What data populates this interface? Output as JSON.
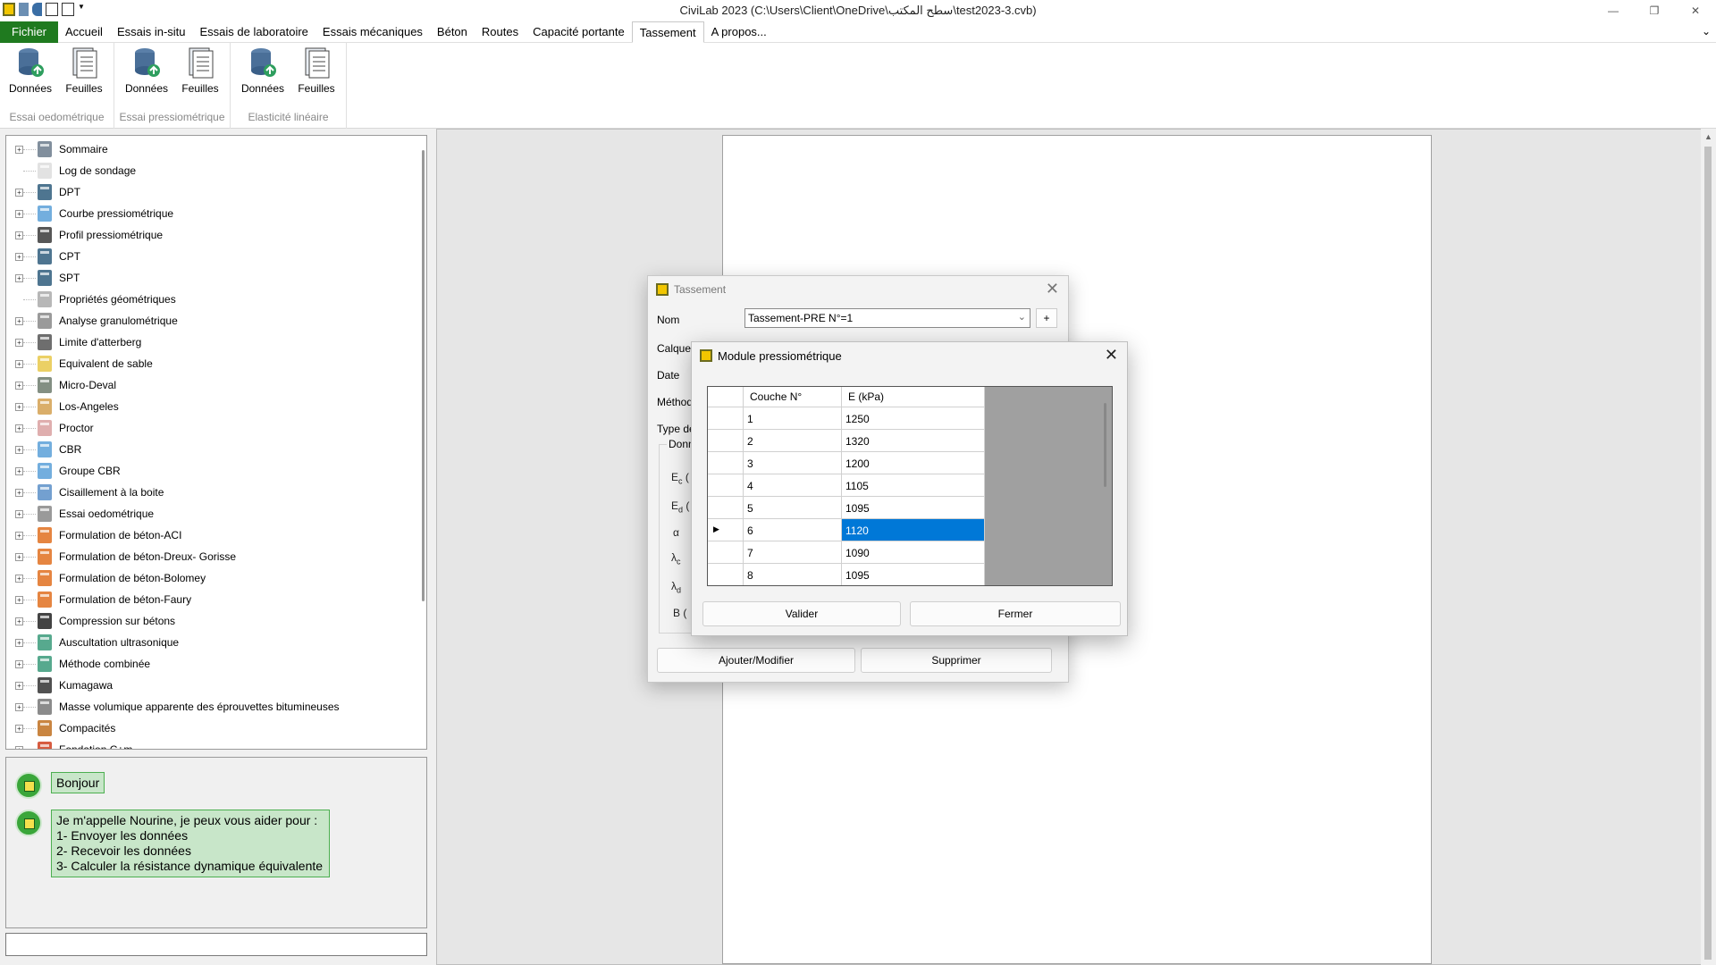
{
  "window": {
    "title": "CiviLab  2023 (C:\\Users\\Client\\OneDrive\\سطح المكتب\\test2023-3.cvb)",
    "minimize": "—",
    "restore": "❐",
    "close": "✕"
  },
  "menu": {
    "items": [
      "Fichier",
      "Accueil",
      "Essais in-situ",
      "Essais de laboratoire",
      "Essais mécaniques",
      "Béton",
      "Routes",
      "Capacité portante",
      "Tassement",
      "A propos..."
    ],
    "active": "Tassement",
    "chevron": "⌄"
  },
  "ribbon": {
    "groups": [
      {
        "label": "Essai oedométrique",
        "buttons": [
          "Données",
          "Feuilles"
        ]
      },
      {
        "label": "Essai pressiométrique",
        "buttons": [
          "Données",
          "Feuilles"
        ]
      },
      {
        "label": "Elasticité linéaire",
        "buttons": [
          "Données",
          "Feuilles"
        ]
      }
    ]
  },
  "tree": {
    "items": [
      "Sommaire",
      "Log de sondage",
      "DPT",
      "Courbe pressiométrique",
      "Profil pressiométrique",
      "CPT",
      "SPT",
      "Propriétés géométriques",
      "Analyse granulométrique",
      "Limite d'atterberg",
      "Equivalent de sable",
      "Micro-Deval",
      "Los-Angeles",
      "Proctor",
      "CBR",
      "Groupe CBR",
      "Cisaillement à la boite",
      "Essai oedométrique",
      "Formulation de béton-ACI",
      "Formulation de béton-Dreux- Gorisse",
      "Formulation de béton-Bolomey",
      "Formulation de béton-Faury",
      "Compression sur bétons",
      "Auscultation ultrasonique",
      "Méthode combinée",
      "Kumagawa",
      "Masse volumique apparente des éprouvettes bitumineuses",
      "Compacités",
      "Fondation C+m"
    ],
    "expander": "+"
  },
  "chat": {
    "greeting": "Bonjour",
    "message_lines": [
      "Je m'appelle Nourine, je peux vous aider pour :",
      "1- Envoyer les données",
      "2- Recevoir les données",
      "3- Calculer la résistance dynamique équivalente"
    ]
  },
  "dialog_tassement": {
    "title": "Tassement",
    "close": "✕",
    "fields": {
      "nom_label": "Nom",
      "nom_value": "Tassement-PRE N°=1",
      "nom_arrow": "⌄",
      "add": "+",
      "calque_label": "Calque",
      "date_label": "Date",
      "methode_label": "Méthod",
      "type_label": "Type de"
    },
    "group_label": "Donn",
    "params": [
      "E",
      "E",
      "α",
      "λ",
      "λ",
      "B ("
    ],
    "param_subs": [
      "c",
      "d",
      "",
      "c",
      "d",
      ""
    ],
    "buttons": {
      "add_modify": "Ajouter/Modifier",
      "delete": "Supprimer"
    }
  },
  "dialog_module": {
    "title": "Module pressiométrique",
    "close": "✕",
    "columns": [
      "Couche N°",
      "E (kPa)"
    ],
    "rows": [
      [
        "1",
        "1250"
      ],
      [
        "2",
        "1320"
      ],
      [
        "3",
        "1200"
      ],
      [
        "4",
        "1105"
      ],
      [
        "5",
        "1095"
      ],
      [
        "6",
        "1120"
      ],
      [
        "7",
        "1090"
      ],
      [
        "8",
        "1095"
      ]
    ],
    "selected_row": 6,
    "row_pointer": "▶",
    "buttons": {
      "validate": "Valider",
      "close": "Fermer"
    }
  }
}
